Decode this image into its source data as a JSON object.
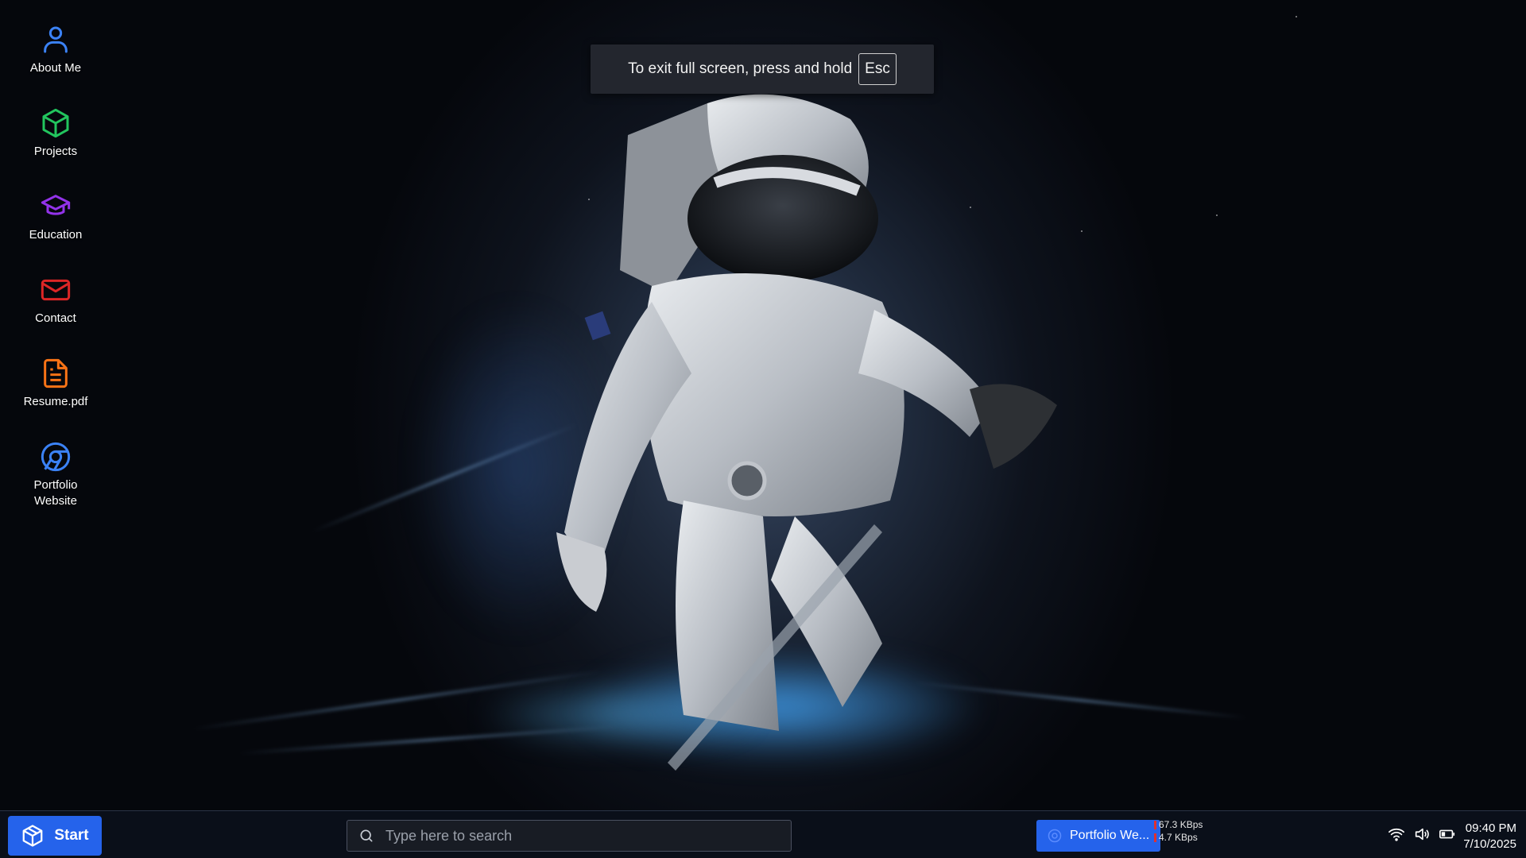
{
  "desktop": {
    "icons": [
      {
        "label": "About Me",
        "icon": "user-icon",
        "color": "#3b82f6"
      },
      {
        "label": "Projects",
        "icon": "cube-icon",
        "color": "#22c55e"
      },
      {
        "label": "Education",
        "icon": "graduation-cap-icon",
        "color": "#9333ea"
      },
      {
        "label": "Contact",
        "icon": "mail-icon",
        "color": "#dc2626"
      },
      {
        "label": "Resume.pdf",
        "icon": "file-text-icon",
        "color": "#f97316"
      },
      {
        "label": "Portfolio Website",
        "icon": "chrome-icon",
        "color": "#3b82f6"
      }
    ]
  },
  "fullscreen_toast": {
    "message": "To exit full screen, press and hold",
    "key": "Esc"
  },
  "taskbar": {
    "start_label": "Start",
    "search_placeholder": "Type here to search",
    "open_app_label": "Portfolio We...",
    "net_upload": "67.3 KBps",
    "net_download": "4.7 KBps",
    "time": "09:40 PM",
    "date": "7/10/2025",
    "accent": "#2563eb"
  }
}
